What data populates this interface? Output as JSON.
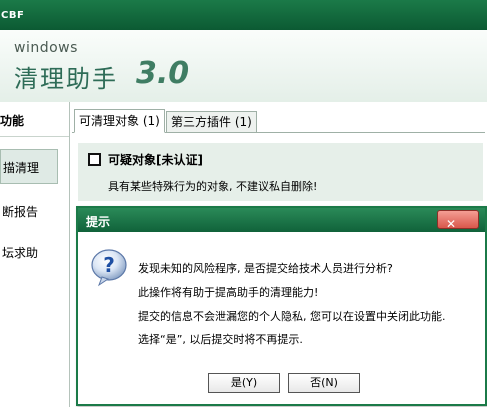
{
  "window": {
    "title": "CBF"
  },
  "banner": {
    "subtitle": "windows",
    "app_name": "清理助手",
    "version": "3.0"
  },
  "sidebar": {
    "header": "功能",
    "items": [
      {
        "label": "描清理",
        "active": true
      },
      {
        "label": "断报告",
        "active": false
      },
      {
        "label": "坛求助",
        "active": false
      }
    ]
  },
  "tabs": [
    {
      "label": "可清理对象 (1)",
      "active": true
    },
    {
      "label": "第三方插件 (1)",
      "active": false
    }
  ],
  "item": {
    "title": "可疑对象[未认证]",
    "checked": false,
    "description": "具有某些特殊行为的对象, 不建议私自删除!"
  },
  "dialog": {
    "title": "提示",
    "close_label": "✕",
    "messages": [
      "发现未知的风险程序, 是否提交给技术人员进行分析?",
      "此操作将有助于提高助手的清理能力!",
      "提交的信息不会泄漏您的个人隐私, 您可以在设置中关闭此功能.",
      "选择“是”, 以后提交时将不再提示."
    ],
    "yes_label": "是(Y)",
    "no_label": "否(N)"
  },
  "colors": {
    "title_bar": "#0c5a33",
    "accent": "#1b7a48",
    "card_bg": "#e6efe9"
  }
}
